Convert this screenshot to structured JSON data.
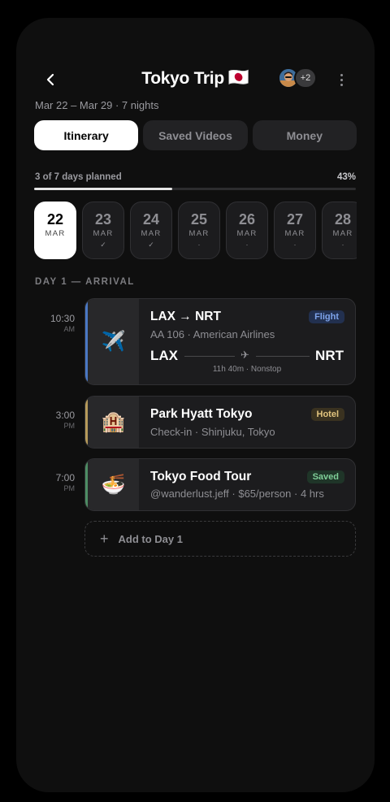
{
  "header": {
    "title": "Tokyo Trip",
    "flag": "🇯🇵",
    "collaborators_extra": "+2",
    "subtitle": "Mar 22 – Mar 29 · 7 nights"
  },
  "tabs": [
    {
      "label": "Itinerary",
      "active": true
    },
    {
      "label": "Saved Videos",
      "active": false
    },
    {
      "label": "Money",
      "active": false
    }
  ],
  "progress": {
    "label": "3 of 7 days planned",
    "percent_label": "43%",
    "fraction": 0.43
  },
  "days": [
    {
      "num": "22",
      "mon": "MAR",
      "mark": "",
      "active": true
    },
    {
      "num": "23",
      "mon": "MAR",
      "mark": "✓",
      "active": false
    },
    {
      "num": "24",
      "mon": "MAR",
      "mark": "✓",
      "active": false
    },
    {
      "num": "25",
      "mon": "MAR",
      "mark": "·",
      "active": false
    },
    {
      "num": "26",
      "mon": "MAR",
      "mark": "·",
      "active": false
    },
    {
      "num": "27",
      "mon": "MAR",
      "mark": "·",
      "active": false
    },
    {
      "num": "28",
      "mon": "MAR",
      "mark": "·",
      "active": false
    }
  ],
  "section_label": "DAY 1 — ARRIVAL",
  "events": [
    {
      "time": "10:30",
      "ampm": "AM",
      "icon": "airplane-icon",
      "emoji": "✈️",
      "title": "LAX → NRT",
      "subtitle": "AA 106 · American Airlines",
      "badge": "Flight",
      "from": "LAX",
      "to": "NRT",
      "meta": "11h 40m · Nonstop",
      "colors": {
        "stripe": "#4a78c4",
        "badge_bg": "#22304f",
        "badge_fg": "#7ea4ec"
      }
    },
    {
      "time": "3:00",
      "ampm": "PM",
      "icon": "hotel-icon",
      "emoji": "🏨",
      "title": "Park Hyatt Tokyo",
      "subtitle": "Check-in · Shinjuku, Tokyo",
      "badge": "Hotel",
      "colors": {
        "stripe": "#b69a5a",
        "badge_bg": "#3a3220",
        "badge_fg": "#e2c47e"
      }
    },
    {
      "time": "7:00",
      "ampm": "PM",
      "icon": "noodles-icon",
      "emoji": "🍜",
      "title": "Tokyo Food Tour",
      "subtitle": "@wanderlust.jeff · $65/person · 4 hrs",
      "badge": "Saved",
      "colors": {
        "stripe": "#4e8d64",
        "badge_bg": "#1f3528",
        "badge_fg": "#7fcf98"
      }
    }
  ],
  "add_label": "Add to Day 1"
}
